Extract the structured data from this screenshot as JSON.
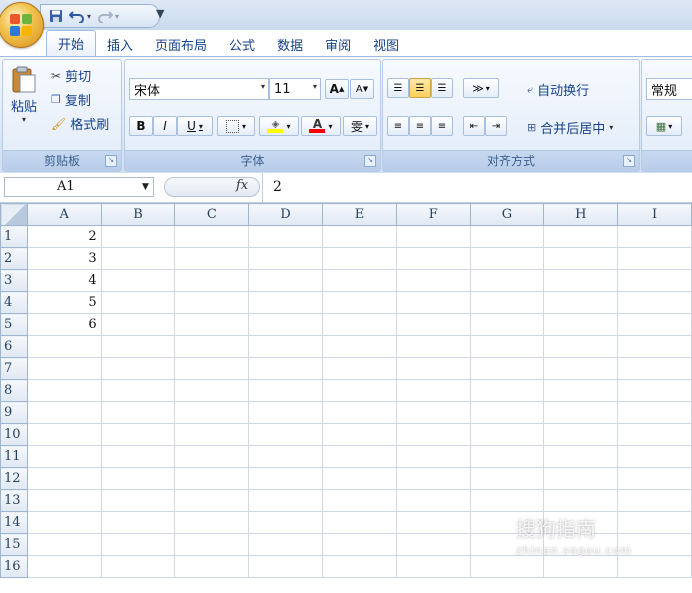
{
  "quick_access": {
    "save_icon": "save-icon",
    "undo_icon": "undo-icon",
    "redo_icon": "redo-icon",
    "customize": "▼"
  },
  "tabs": [
    {
      "label": "开始",
      "active": true
    },
    {
      "label": "插入"
    },
    {
      "label": "页面布局"
    },
    {
      "label": "公式"
    },
    {
      "label": "数据"
    },
    {
      "label": "审阅"
    },
    {
      "label": "视图"
    }
  ],
  "clipboard": {
    "paste": "粘贴",
    "cut": "剪切",
    "copy": "复制",
    "format_painter": "格式刷",
    "group_label": "剪贴板"
  },
  "font": {
    "name": "宋体",
    "size": "11",
    "grow": "A",
    "shrink": "A",
    "bold": "B",
    "italic": "I",
    "underline": "U",
    "group_label": "字体",
    "phonetic": "雯",
    "fill_color": "#ffff00",
    "font_color": "#ff0000"
  },
  "alignment": {
    "wrap_text": "自动换行",
    "merge_center": "合并后居中",
    "group_label": "对齐方式"
  },
  "number": {
    "format": "常规"
  },
  "name_box": {
    "value": "A1"
  },
  "formula_bar": {
    "fx": "fx",
    "value": "2"
  },
  "sheet": {
    "columns": [
      "A",
      "B",
      "C",
      "D",
      "E",
      "F",
      "G",
      "H",
      "I"
    ],
    "rows": [
      "1",
      "2",
      "3",
      "4",
      "5",
      "6",
      "7",
      "8",
      "9",
      "10",
      "11",
      "12",
      "13",
      "14",
      "15",
      "16"
    ],
    "column_a_values": [
      "2",
      "3",
      "4",
      "5",
      "6",
      "",
      "",
      "",
      "",
      "",
      "",
      "",
      "",
      "",
      "",
      ""
    ]
  },
  "watermark": {
    "text": "搜狗指南",
    "sub": "zhinan.sogou.com"
  }
}
